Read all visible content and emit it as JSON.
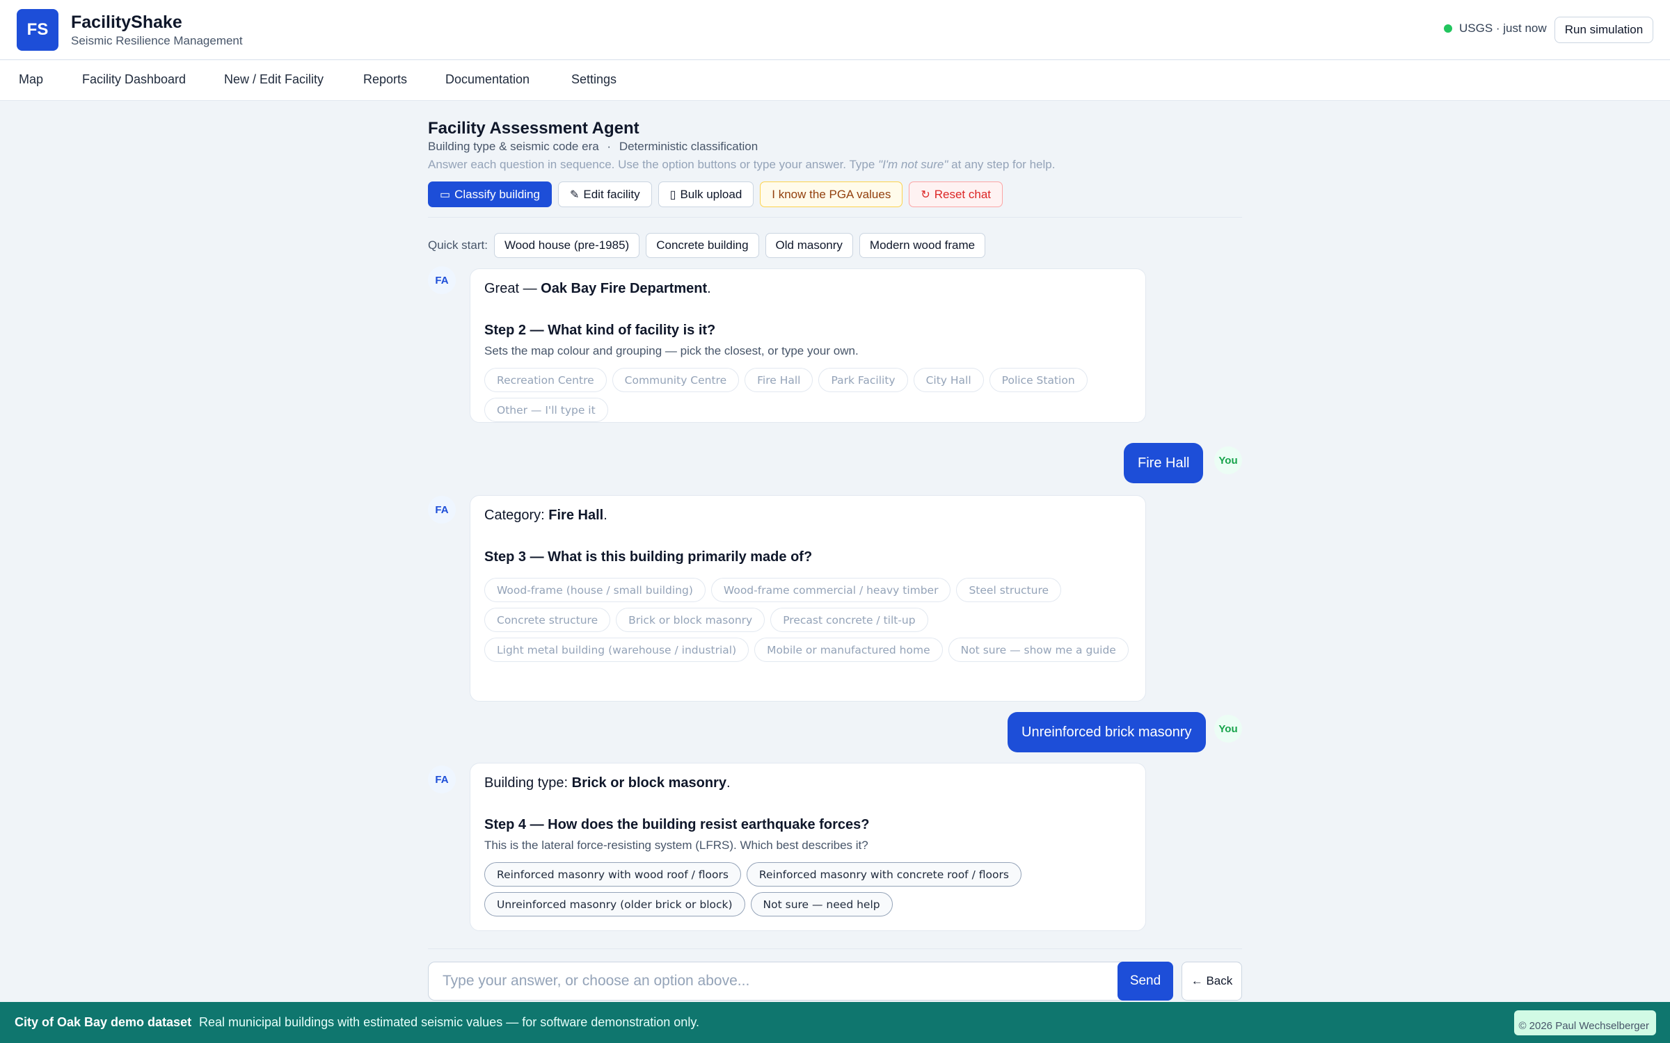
{
  "header": {
    "logo": "FS",
    "title": "FacilityShake",
    "subtitle": "Seismic Resilience Management",
    "status": "USGS · just now",
    "run_button": "Run simulation"
  },
  "nav": [
    "Map",
    "Facility Dashboard",
    "New / Edit Facility",
    "Reports",
    "Documentation",
    "Settings"
  ],
  "agent": {
    "title": "Facility Assessment Agent",
    "subline_a": "Building type & seismic code era",
    "subline_sep": "·",
    "subline_b": "Deterministic classification",
    "help_a": "Answer each question in sequence. Use the option buttons or type your answer. Type ",
    "help_em": "\"I'm not sure\"",
    "help_b": " at any step for help.",
    "actions": {
      "classify": "Classify building",
      "edit": "Edit facility",
      "bulk": "Bulk upload",
      "pga": "I know the PGA values",
      "reset": "Reset chat"
    },
    "quick_label": "Quick start:",
    "quick_start": [
      "Wood house (pre-1985)",
      "Concrete building",
      "Old masonry",
      "Modern wood frame"
    ]
  },
  "avatars": {
    "bot": "FA",
    "user": "You"
  },
  "messages": [
    {
      "lead": "Great — ",
      "lead_bold": "Oak Bay Fire Department",
      "lead_end": ".",
      "step": "Step 2 — What kind of facility is it?",
      "desc": "Sets the map colour and grouping — pick the closest, or type your own.",
      "options": [
        "Recreation Centre",
        "Community Centre",
        "Fire Hall",
        "Park Facility",
        "City Hall",
        "Police Station",
        "Other — I'll type it"
      ]
    },
    {
      "user": "Fire Hall"
    },
    {
      "lead": "Category: ",
      "lead_bold": "Fire Hall",
      "lead_end": ".",
      "step": "Step 3 — What is this building primarily made of?",
      "options": [
        "Wood-frame (house / small building)",
        "Wood-frame commercial / heavy timber",
        "Steel structure",
        "Concrete structure",
        "Brick or block masonry",
        "Precast concrete / tilt-up",
        "Light metal building (warehouse / industrial)",
        "Mobile or manufactured home",
        "Not sure — show me a guide"
      ]
    },
    {
      "user": "Unreinforced brick masonry"
    },
    {
      "lead": "Building type: ",
      "lead_bold": "Brick or block masonry",
      "lead_end": ".",
      "step": "Step 4 — How does the building resist earthquake forces?",
      "desc": "This is the lateral force-resisting system (LFRS). Which best describes it?",
      "options": [
        "Reinforced masonry with wood roof / floors",
        "Reinforced masonry with concrete roof / floors",
        "Unreinforced masonry (older brick or block)",
        "Not sure — need help"
      ]
    }
  ],
  "composer": {
    "placeholder": "Type your answer, or choose an option above...",
    "send": "Send",
    "back": "← Back"
  },
  "footer": {
    "dataset": "City of Oak Bay demo dataset",
    "note": "Real municipal buildings with estimated seismic values — for software demonstration only.",
    "copyright": "© 2026 Paul Wechselberger"
  },
  "colors": {
    "brand": "#1d4ed8",
    "footer": "#0f766e",
    "status": "#22c55e"
  }
}
